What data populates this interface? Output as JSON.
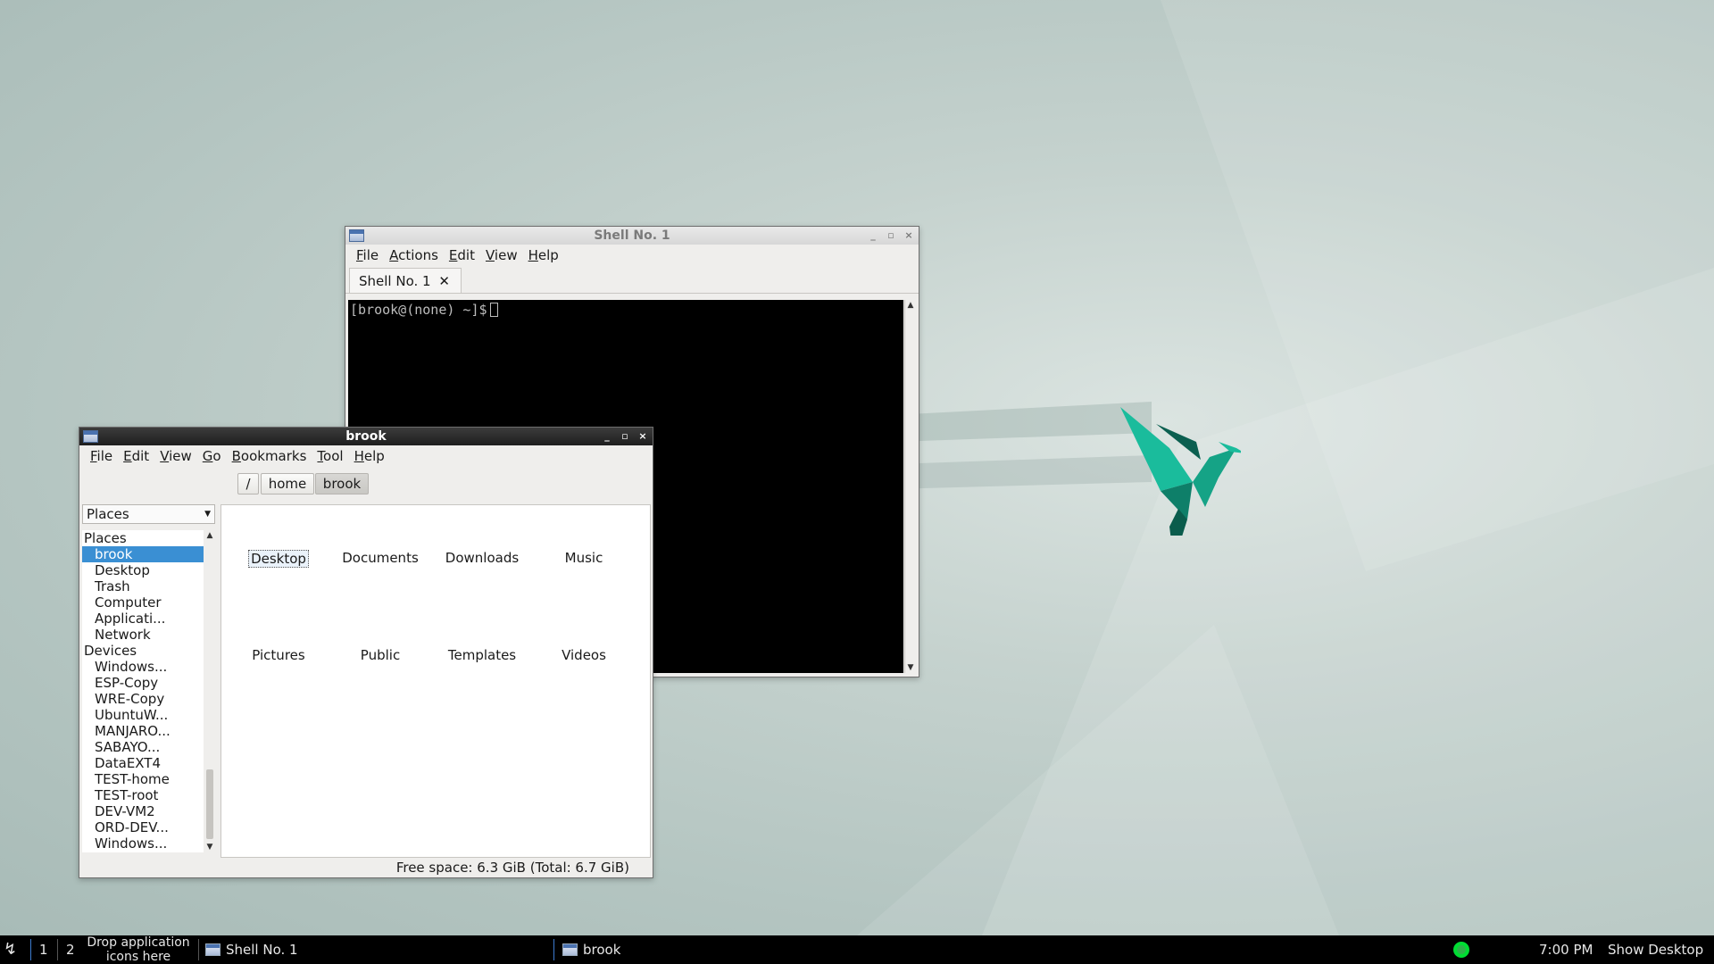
{
  "terminal": {
    "title": "Shell No. 1",
    "menu": [
      "File",
      "Actions",
      "Edit",
      "View",
      "Help"
    ],
    "tab_label": "Shell No. 1",
    "prompt": "[brook@(none) ~]$"
  },
  "filemgr": {
    "title": "brook",
    "menu": [
      "File",
      "Edit",
      "View",
      "Go",
      "Bookmarks",
      "Tool",
      "Help"
    ],
    "path": [
      "/",
      "home",
      "brook"
    ],
    "side_pane_mode": "Places",
    "tree": [
      {
        "label": "Places",
        "kind": "group"
      },
      {
        "label": "brook",
        "kind": "child",
        "selected": true
      },
      {
        "label": "Desktop",
        "kind": "child"
      },
      {
        "label": "Trash",
        "kind": "child"
      },
      {
        "label": "Computer",
        "kind": "child"
      },
      {
        "label": "Applicati...",
        "kind": "child"
      },
      {
        "label": "Network",
        "kind": "child"
      },
      {
        "label": "Devices",
        "kind": "group"
      },
      {
        "label": "Windows...",
        "kind": "child"
      },
      {
        "label": "ESP-Copy",
        "kind": "child"
      },
      {
        "label": "WRE-Copy",
        "kind": "child"
      },
      {
        "label": "UbuntuW...",
        "kind": "child"
      },
      {
        "label": "MANJARO...",
        "kind": "child"
      },
      {
        "label": "SABAYO...",
        "kind": "child"
      },
      {
        "label": "DataEXT4",
        "kind": "child"
      },
      {
        "label": "TEST-home",
        "kind": "child"
      },
      {
        "label": "TEST-root",
        "kind": "child"
      },
      {
        "label": "DEV-VM2",
        "kind": "child"
      },
      {
        "label": "ORD-DEV...",
        "kind": "child"
      },
      {
        "label": "Windows...",
        "kind": "child"
      }
    ],
    "folders": [
      "Desktop",
      "Documents",
      "Downloads",
      "Music",
      "Pictures",
      "Public",
      "Templates",
      "Videos"
    ],
    "status": "Free space: 6.3 GiB (Total: 6.7 GiB)"
  },
  "taskbar": {
    "desktops": [
      "1",
      "2"
    ],
    "drop_hint": "Drop application icons here",
    "tasks": [
      "Shell No. 1",
      "brook"
    ],
    "clock": "7:00 PM",
    "show_desktop": "Show Desktop"
  },
  "icons": {
    "menu_button": "refresh-arrow-icon",
    "window": "window-icon",
    "tray": "network-status-icon"
  },
  "colors": {
    "selection": "#3a8fd3",
    "bird": "#16a88a",
    "taskbar": "#000000"
  }
}
